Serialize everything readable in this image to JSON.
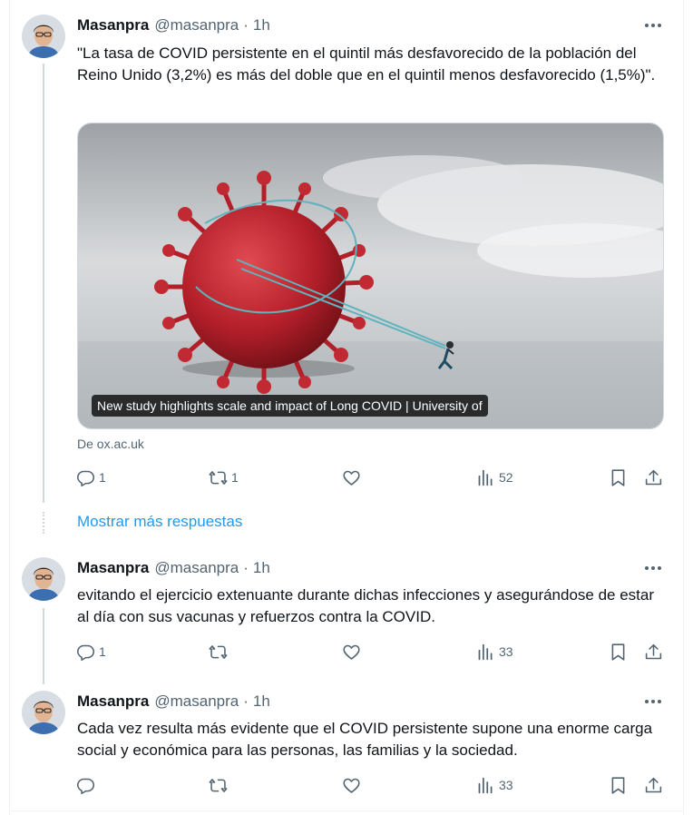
{
  "tweets": [
    {
      "name": "Masanpra",
      "handle": "@masanpra",
      "time": "1h",
      "text": "\"La tasa de COVID persistente en el quintil más desfavorecido de la población del Reino Unido (3,2%) es más del doble que en el quintil menos desfavorecido (1,5%)\".",
      "card": {
        "caption": "New study highlights scale and impact of Long COVID | University of",
        "source": "De ox.ac.uk"
      },
      "replies": "1",
      "retweets": "1",
      "likes": "",
      "views": "52"
    },
    {
      "name": "Masanpra",
      "handle": "@masanpra",
      "time": "1h",
      "text": "evitando el ejercicio extenuante durante dichas infecciones y asegurándose de estar al día con sus vacunas y refuerzos contra la COVID.",
      "replies": "1",
      "retweets": "",
      "likes": "",
      "views": "33"
    },
    {
      "name": "Masanpra",
      "handle": "@masanpra",
      "time": "1h",
      "text": "Cada vez resulta más evidente que el COVID persistente supone una enorme carga social y económica para las personas, las familias y la sociedad.",
      "replies": "",
      "retweets": "",
      "likes": "",
      "views": "33"
    }
  ],
  "show_more": "Mostrar más respuestas",
  "icons": [
    "avatar",
    "more-icon",
    "reply-icon",
    "retweet-icon",
    "like-icon",
    "views-icon",
    "bookmark-icon",
    "share-icon"
  ],
  "colors": {
    "link": "#1d9bf0",
    "secondary_text": "#536471",
    "text": "#0f1419",
    "virus": "#c0262f"
  }
}
